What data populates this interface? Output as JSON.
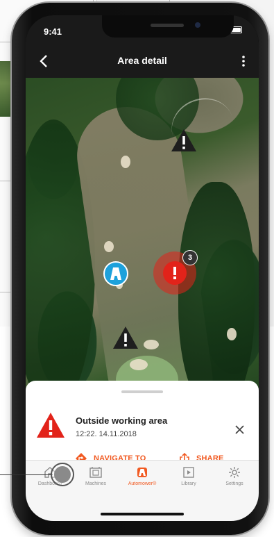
{
  "status_bar": {
    "time": "9:41"
  },
  "app_bar": {
    "title": "Area detail",
    "back_icon": "chevron-left-icon",
    "more_icon": "more-vertical-icon"
  },
  "map": {
    "markers": [
      {
        "type": "warning",
        "icon": "warning-triangle-icon"
      },
      {
        "type": "warning",
        "icon": "warning-triangle-icon"
      },
      {
        "type": "robot",
        "icon": "automower-icon",
        "color": "#1da1db"
      },
      {
        "type": "alert",
        "icon": "alert-exclamation-icon",
        "color": "#e2231a",
        "count": "3"
      }
    ]
  },
  "sheet": {
    "title": "Outside working area",
    "timestamp": "12:22. 14.11.2018",
    "alert_color": "#e2231a",
    "actions": [
      {
        "label": "NAVIGATE TO",
        "icon": "navigate-diamond-icon"
      },
      {
        "label": "SHARE",
        "icon": "share-icon"
      }
    ]
  },
  "tabs": [
    {
      "label": "Dashboard",
      "icon": "home-icon"
    },
    {
      "label": "Machines",
      "icon": "machines-icon"
    },
    {
      "label": "Automower®",
      "icon": "automower-icon",
      "active": true
    },
    {
      "label": "Library",
      "icon": "library-icon"
    },
    {
      "label": "Settings",
      "icon": "gear-icon"
    }
  ],
  "accent_color": "#f15a22"
}
